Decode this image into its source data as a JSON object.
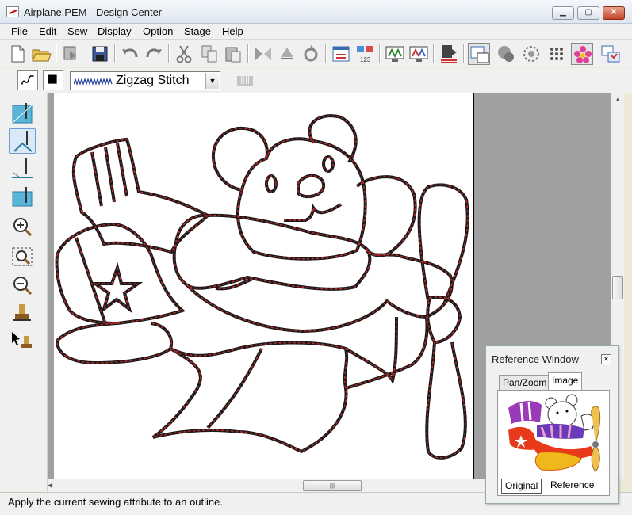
{
  "window": {
    "title": "Airplane.PEM - Design Center"
  },
  "menu": {
    "items": [
      {
        "label": "File",
        "key": "F",
        "rest": "ile"
      },
      {
        "label": "Edit",
        "key": "E",
        "rest": "dit"
      },
      {
        "label": "Sew",
        "key": "S",
        "rest": "ew"
      },
      {
        "label": "Display",
        "key": "D",
        "rest": "isplay"
      },
      {
        "label": "Option",
        "key": "O",
        "rest": "ption"
      },
      {
        "label": "Stage",
        "key": "S",
        "rest": "tage"
      },
      {
        "label": "Help",
        "key": "H",
        "rest": "elp"
      }
    ]
  },
  "sewing_attributes": {
    "stitch_type": "Zigzag Stitch"
  },
  "reference_window": {
    "title": "Reference Window",
    "tabs": [
      "Pan/Zoom",
      "Image"
    ],
    "active_tab": "Image",
    "buttons": [
      "Original",
      "Reference"
    ]
  },
  "status": {
    "text": "Apply the current sewing attribute to an outline."
  },
  "colors": {
    "outline_red": "#c62828",
    "outline_black": "#1a1a1a",
    "accent": "#3a8fd6"
  }
}
